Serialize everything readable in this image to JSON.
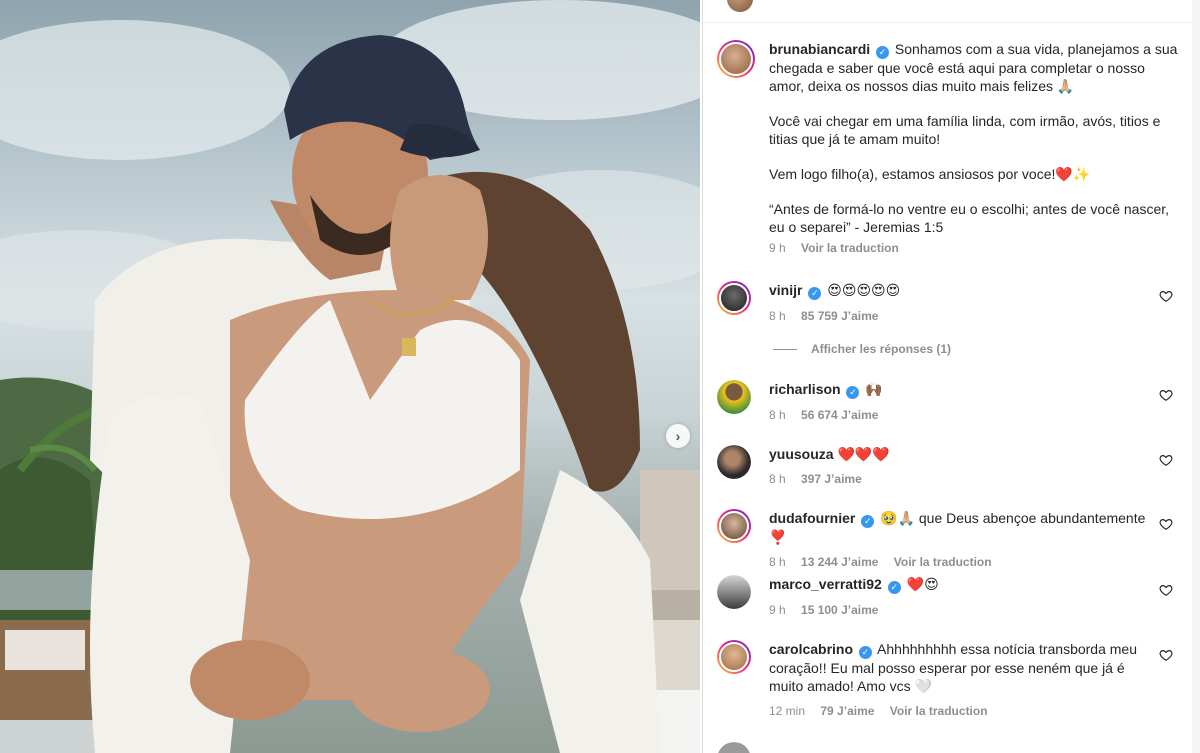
{
  "post": {
    "author": "brunabiancardi",
    "caption_paragraphs": [
      "Sonhamos com a sua vida, planejamos a sua chegada e saber que você está aqui para completar o nosso amor, deixa os nossos dias muito mais felizes 🙏🏼",
      "Você vai chegar em uma família linda, com irmão, avós, titios e titias que já te amam muito!",
      "Vem logo filho(a), estamos ansiosos por voce!❤️✨",
      "“Antes de formá-lo no ventre eu o escolhi; antes de você nascer, eu o separei” - Jeremias 1:5"
    ],
    "time": "9 h",
    "translate": "Voir la traduction"
  },
  "comments": [
    {
      "user": "vinijr",
      "verified": true,
      "text": "😍😍😍😍😍",
      "time": "8 h",
      "likes": "85 759 J’aime",
      "translate": ""
    },
    {
      "user": "richarlison",
      "verified": true,
      "text": "🙌🏾",
      "time": "8 h",
      "likes": "56 674 J’aime",
      "translate": ""
    },
    {
      "user": "yuusouza",
      "verified": false,
      "text": "❤️❤️❤️",
      "time": "8 h",
      "likes": "397 J’aime",
      "translate": ""
    },
    {
      "user": "dudafournier",
      "verified": true,
      "text": "🥹🙏🏼 que Deus abençoe abundantemente ❣️",
      "time": "8 h",
      "likes": "13 244 J’aime",
      "translate": "Voir la traduction"
    },
    {
      "user": "marco_verratti92",
      "verified": true,
      "text": "❤️😍",
      "time": "9 h",
      "likes": "15 100 J’aime",
      "translate": ""
    },
    {
      "user": "carolcabrino",
      "verified": true,
      "text": "Ahhhhhhhhh essa notícia transborda meu coração!! Eu mal posso esperar por esse neném que já é muito amado! Amo vcs 🤍",
      "time": "12 min",
      "likes": "79 J’aime",
      "translate": "Voir la traduction"
    }
  ],
  "replies_label": "Afficher les réponses (1)",
  "icons": {
    "verified": "verified-badge-icon",
    "heart": "heart-outline-icon",
    "next": "chevron-right-icon"
  },
  "colors": {
    "verified": "#3897f0",
    "secondary_text": "#8e8e8e",
    "primary_text": "#262626"
  }
}
